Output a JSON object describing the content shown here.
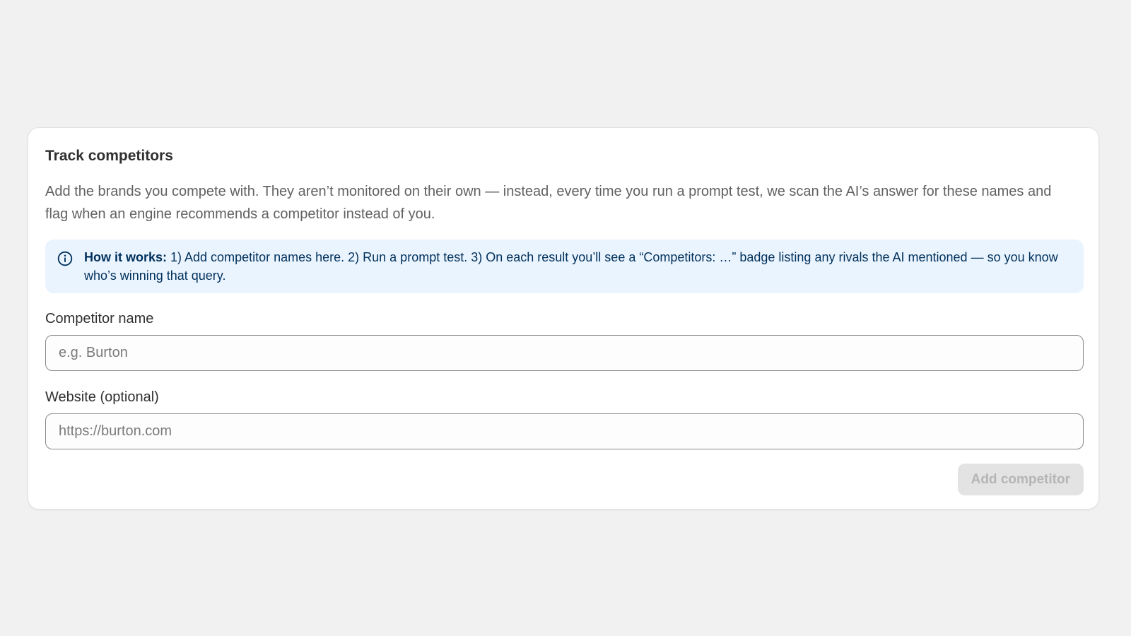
{
  "card": {
    "title": "Track competitors",
    "description": "Add the brands you compete with. They aren’t monitored on their own — instead, every time you run a prompt test, we scan the AI’s answer for these names and flag when an engine recommends a competitor instead of you."
  },
  "banner": {
    "icon": "info-icon",
    "heading": "How it works:",
    "body": " 1) Add competitor names here. 2) Run a prompt test. 3) On each result you’ll see a “Competitors: …” badge listing any rivals the AI mentioned — so you know who’s winning that query.",
    "bg_color": "#eaf4ff",
    "text_color": "#00305a"
  },
  "form": {
    "name_label": "Competitor name",
    "name_value": "",
    "name_placeholder": "e.g. Burton",
    "website_label": "Website (optional)",
    "website_value": "",
    "website_placeholder": "https://burton.com"
  },
  "actions": {
    "add_label": "Add competitor",
    "add_disabled": true
  }
}
